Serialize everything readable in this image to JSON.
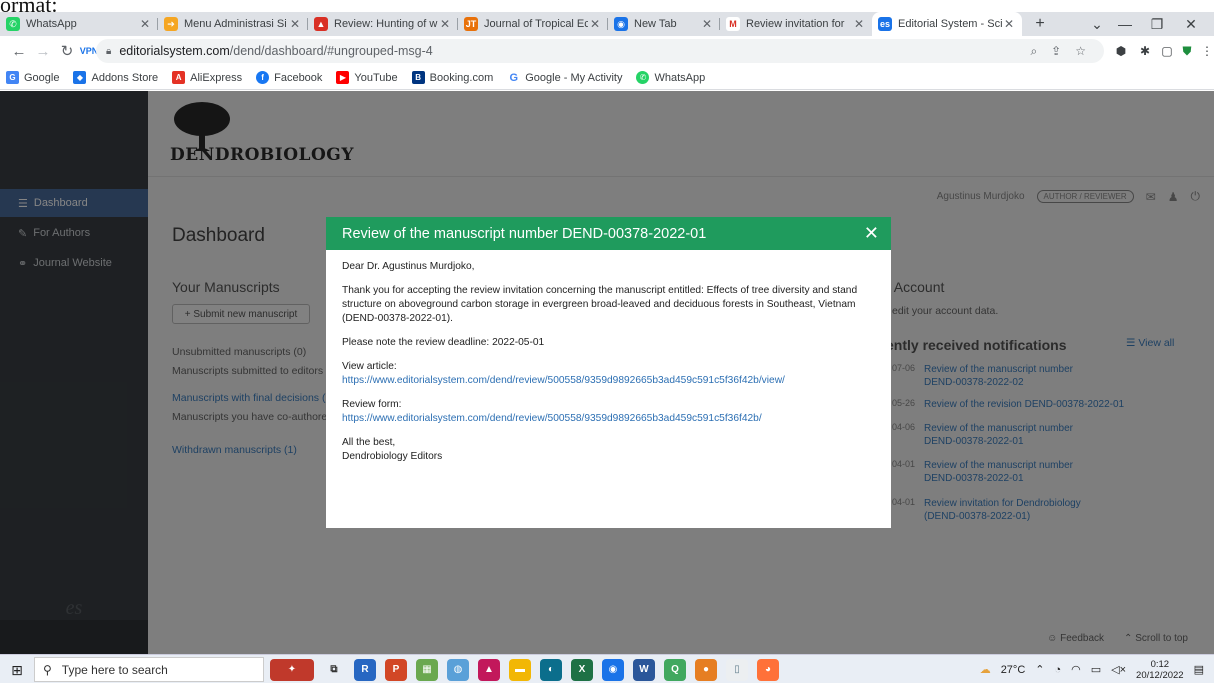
{
  "crop_text": "ormat:",
  "tabs": [
    {
      "title": "WhatsApp",
      "icon": "whatsapp-icon",
      "color": "#25d366",
      "glyph": "✆"
    },
    {
      "title": "Menu Administrasi Si",
      "icon": "sheet-icon",
      "color": "#f5a623",
      "glyph": "➔"
    },
    {
      "title": "Review: Hunting of w",
      "icon": "review-icon",
      "color": "#d93025",
      "glyph": "▲"
    },
    {
      "title": "Journal of Tropical Eco",
      "icon": "journal-icon",
      "color": "#e8710a",
      "glyph": "JT"
    },
    {
      "title": "New Tab",
      "icon": "chrome-icon",
      "color": "#1a73e8",
      "glyph": "◉"
    },
    {
      "title": "Review invitation for",
      "icon": "gmail-icon",
      "color": "#d93025",
      "glyph": "M"
    },
    {
      "title": "Editorial System - Scie",
      "icon": "es-icon",
      "color": "#1a73e8",
      "glyph": "es"
    }
  ],
  "address": {
    "host": "editorialsystem.com",
    "path": "/dend/dashboard/#ungrouped-msg-4"
  },
  "bookmarks": [
    {
      "label": "Google",
      "color": "#4285f4",
      "glyph": "G"
    },
    {
      "label": "Addons Store",
      "color": "#1a73e8",
      "glyph": "◆"
    },
    {
      "label": "AliExpress",
      "color": "#e43225",
      "glyph": "A"
    },
    {
      "label": "Facebook",
      "color": "#1877f2",
      "glyph": "f"
    },
    {
      "label": "YouTube",
      "color": "#ff0000",
      "glyph": "▶"
    },
    {
      "label": "Booking.com",
      "color": "#003580",
      "glyph": "B"
    },
    {
      "label": "Google - My Activity",
      "color": "#4285f4",
      "glyph": "G"
    },
    {
      "label": "WhatsApp",
      "color": "#25d366",
      "glyph": "✆"
    }
  ],
  "brand": "DENDROBIOLOGY",
  "sidebar": {
    "items": [
      {
        "label": "Dashboard",
        "icon": "list-icon"
      },
      {
        "label": "For Authors",
        "icon": "pencil-icon"
      },
      {
        "label": "Journal Website",
        "icon": "link-icon"
      }
    ],
    "logo": "es"
  },
  "user": {
    "name": "Agustinus Murdjoko",
    "role": "AUTHOR / REVIEWER"
  },
  "dashboard": {
    "title": "Dashboard",
    "manuscripts_heading": "Your Manuscripts",
    "submit_button": "+ Submit new manuscript",
    "unsubmitted": "Unsubmitted manuscripts (0)",
    "submitted": "Manuscripts submitted to editors",
    "final": "Manuscripts with final decisions (",
    "coauthored": "Manuscripts you have co-authored",
    "withdrawn": "Withdrawn manuscripts (1)",
    "account_heading": "r Account",
    "account_text": "edit your account data.",
    "notif_heading": "ently received notifications",
    "view_all": "☰ View all",
    "notifications": [
      {
        "time": "07-06",
        "text": "Review of the manuscript number DEND-00378-2022-02"
      },
      {
        "time": "05-26",
        "text": "Review of the revision DEND-00378-2022-01"
      },
      {
        "time": "04-06",
        "text": "Review of the manuscript number DEND-00378-2022-01"
      },
      {
        "time": "04-01",
        "text": "Review of the manuscript number DEND-00378-2022-01"
      },
      {
        "time": "04-01",
        "text": "Review invitation for Dendrobiology (DEND-00378-2022-01)"
      }
    ],
    "feedback": "☺ Feedback",
    "scroll_top": "⌃ Scroll to top"
  },
  "modal": {
    "title": "Review of the manuscript number DEND-00378-2022-01",
    "greeting": "Dear Dr. Agustinus Murdjoko,",
    "body": "Thank you for accepting the review invitation concerning the manuscript entitled: Effects of tree diversity and stand structure on aboveground carbon storage in evergreen broad-leaved and deciduous forests in Southeast, Vietnam (DEND-00378-2022-01).",
    "deadline": "Please note the review deadline: 2022-05-01",
    "view_label": "View article:",
    "view_url": "https://www.editorialsystem.com/dend/review/500558/9359d9892665b3ad459c591c5f36f42b/view/",
    "form_label": "Review form:",
    "form_url": "https://www.editorialsystem.com/dend/review/500558/9359d9892665b3ad459c591c5f36f42b/",
    "signoff": "All the best,",
    "signature": "Dendrobiology Editors"
  },
  "taskbar": {
    "search_placeholder": "Type here to search",
    "weather": "27°C",
    "time": "0:12",
    "date": "20/12/2022"
  }
}
